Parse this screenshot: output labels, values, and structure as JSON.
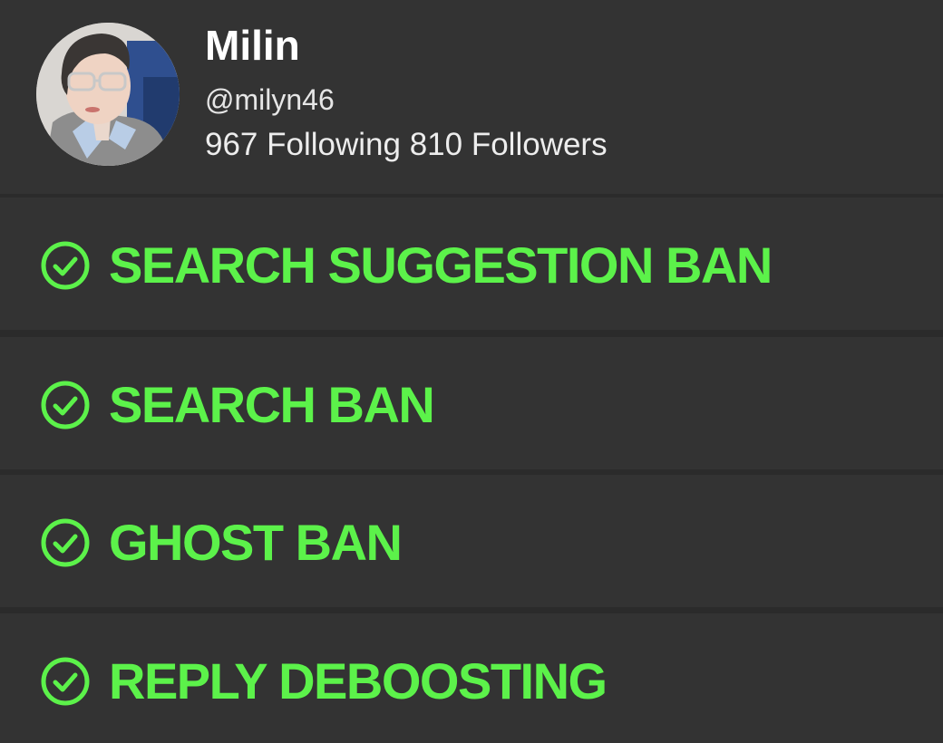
{
  "profile": {
    "name": "Milin",
    "handle": "@milyn46",
    "following_count": "967",
    "following_label": "Following",
    "followers_count": "810",
    "followers_label": "Followers"
  },
  "checks": [
    {
      "label": "SEARCH SUGGESTION BAN",
      "icon": "check-circle-icon",
      "status": "passed"
    },
    {
      "label": "SEARCH BAN",
      "icon": "check-circle-icon",
      "status": "passed"
    },
    {
      "label": "GHOST BAN",
      "icon": "check-circle-icon",
      "status": "passed"
    },
    {
      "label": "REPLY DEBOOSTING",
      "icon": "check-circle-icon",
      "status": "passed"
    }
  ],
  "colors": {
    "background": "#2b2b2b",
    "panel": "#333333",
    "pass_green": "#5cf24a",
    "text_white": "#ffffff"
  }
}
